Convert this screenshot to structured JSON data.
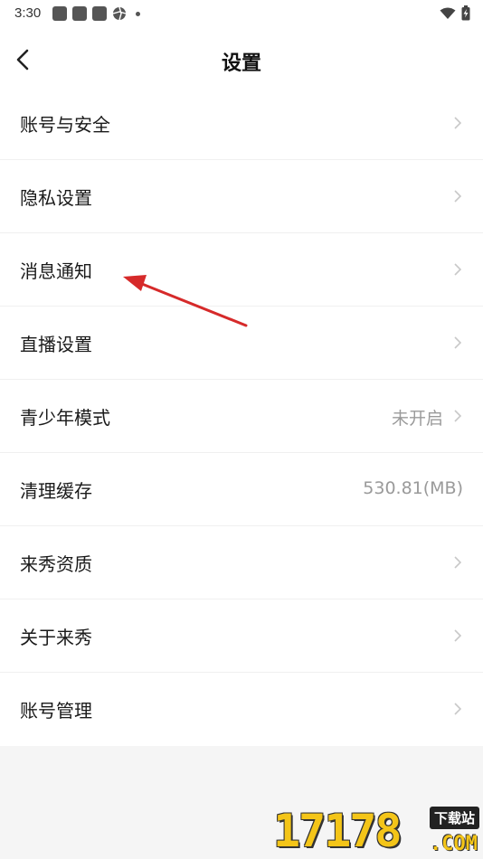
{
  "status_bar": {
    "time": "3:30",
    "icons": [
      "notification-square-icon",
      "notification-square-icon",
      "notification-square-icon",
      "aperture-icon",
      "dot-icon"
    ],
    "right_icons": [
      "wifi-icon",
      "battery-charging-icon"
    ]
  },
  "header": {
    "title": "设置",
    "back_icon": "chevron-left-icon"
  },
  "settings": {
    "items": [
      {
        "label": "账号与安全",
        "value": ""
      },
      {
        "label": "隐私设置",
        "value": ""
      },
      {
        "label": "消息通知",
        "value": ""
      },
      {
        "label": "直播设置",
        "value": ""
      },
      {
        "label": "青少年模式",
        "value": "未开启"
      },
      {
        "label": "清理缓存",
        "value": "530.81(MB)"
      },
      {
        "label": "来秀资质",
        "value": ""
      },
      {
        "label": "关于来秀",
        "value": ""
      },
      {
        "label": "账号管理",
        "value": ""
      }
    ]
  },
  "watermark": {
    "digits": "17178",
    "tag": "下载站",
    "domain": ".COM"
  },
  "colors": {
    "background": "#f5f5f5",
    "row_background": "#ffffff",
    "chevron": "#c8c8c8",
    "value_text": "#9a9a9a",
    "annotation_arrow": "#d62a2a",
    "watermark_yellow": "#f4c518"
  }
}
